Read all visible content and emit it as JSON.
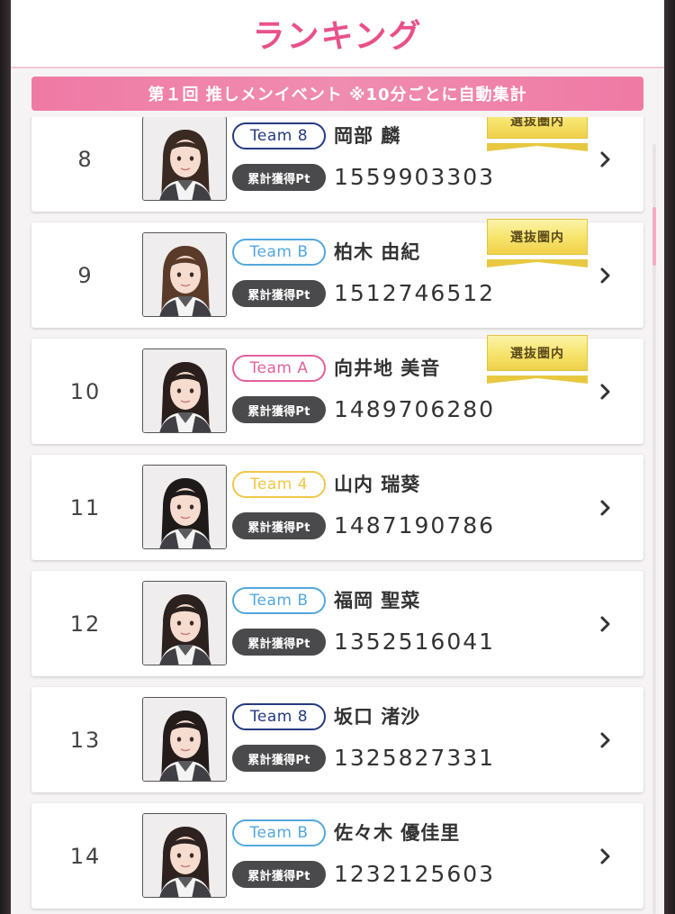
{
  "header": {
    "title": "ランキング"
  },
  "event_banner": {
    "text": "第１回 推しメンイベント ※10分ごとに自動集計"
  },
  "labels": {
    "points_badge": "累計獲得Pt",
    "senbatsu": "選抜圏内"
  },
  "colors": {
    "accent_pink": "#e8518a",
    "banner_pink": "#ef7aa4",
    "team_8": "#243b80",
    "team_b": "#52a8dc",
    "team_a": "#e2619d",
    "team_4": "#f1c648",
    "points_badge_bg": "#4a4a4c",
    "senbatsu_gold": "#f7e36a"
  },
  "rows": [
    {
      "rank": "8",
      "team": "Team 8",
      "team_key": "8",
      "name": "岡部 麟",
      "points": "1559903303",
      "senbatsu": true
    },
    {
      "rank": "9",
      "team": "Team B",
      "team_key": "b",
      "name": "柏木 由紀",
      "points": "1512746512",
      "senbatsu": true
    },
    {
      "rank": "10",
      "team": "Team A",
      "team_key": "a",
      "name": "向井地 美音",
      "points": "1489706280",
      "senbatsu": true
    },
    {
      "rank": "11",
      "team": "Team 4",
      "team_key": "4",
      "name": "山内 瑞葵",
      "points": "1487190786",
      "senbatsu": false
    },
    {
      "rank": "12",
      "team": "Team B",
      "team_key": "b",
      "name": "福岡 聖菜",
      "points": "1352516041",
      "senbatsu": false
    },
    {
      "rank": "13",
      "team": "Team 8",
      "team_key": "8",
      "name": "坂口 渚沙",
      "points": "1325827331",
      "senbatsu": false
    },
    {
      "rank": "14",
      "team": "Team B",
      "team_key": "b",
      "name": "佐々木 優佳里",
      "points": "1232125603",
      "senbatsu": false
    }
  ],
  "icons": {
    "chevron": "chevron-right-icon",
    "photo": "member-photo"
  }
}
